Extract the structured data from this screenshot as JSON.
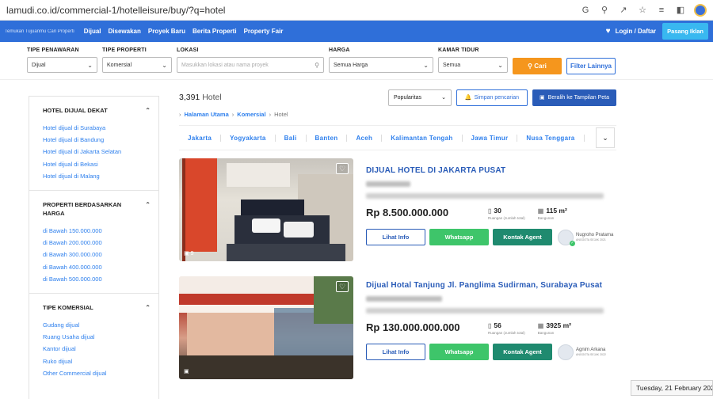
{
  "browser": {
    "url": "lamudi.co.id/commercial-1/hotelleisure/buy/?q=hotel",
    "icons": [
      "google-icon",
      "zoom-icon",
      "share-icon",
      "star-icon",
      "reading-list-icon",
      "sidebar-icon",
      "profile-icon"
    ]
  },
  "topnav": {
    "tagline": "Temukan Tujuanmu Cari Properti",
    "links": [
      "Dijual",
      "Disewakan",
      "Proyek Baru",
      "Berita Properti",
      "Property Fair"
    ],
    "login": "Login / Daftar",
    "pasang": "Pasang Iklan"
  },
  "filters": {
    "tipe_penawaran": {
      "label": "TIPE PENAWARAN",
      "value": "Dijual"
    },
    "tipe_properti": {
      "label": "TIPE PROPERTI",
      "value": "Komersial"
    },
    "lokasi": {
      "label": "LOKASI",
      "placeholder": "Masukkan lokasi atau nama proyek"
    },
    "harga": {
      "label": "HARGA",
      "value": "Semua Harga"
    },
    "kamar": {
      "label": "KAMAR TIDUR",
      "value": "Semua"
    },
    "cari": "Cari",
    "filter_lainnya": "Filter Lainnya"
  },
  "sidebar": {
    "sections": [
      {
        "title": "HOTEL DIJUAL DEKAT",
        "links": [
          "Hotel dijual di Surabaya",
          "Hotel dijual di Bandung",
          "Hotel dijual di Jakarta Selatan",
          "Hotel dijual di Bekasi",
          "Hotel dijual di Malang"
        ]
      },
      {
        "title": "PROPERTI BERDASARKAN HARGA",
        "links": [
          "di Bawah 150.000.000",
          "di Bawah 200.000.000",
          "di Bawah 300.000.000",
          "di Bawah 400.000.000",
          "di Bawah 500.000.000"
        ]
      },
      {
        "title": "TIPE KOMERSIAL",
        "links": [
          "Gudang dijual",
          "Ruang Usaha dijual",
          "Kantor dijual",
          "Ruko dijual",
          "Other Commercial dijual"
        ]
      }
    ]
  },
  "results": {
    "count": "3,391",
    "noun": "Hotel",
    "sort": "Popularitas",
    "simpan": "Simpan pencarian",
    "peta": "Beralih ke Tampilan Peta"
  },
  "breadcrumb": [
    "Halaman Utama",
    "Komersial",
    "Hotel"
  ],
  "loctabs": [
    "Jakarta",
    "Yogyakarta",
    "Bali",
    "Banten",
    "Aceh",
    "Kalimantan Tengah",
    "Jawa Timur",
    "Nusa Tenggara"
  ],
  "listings": [
    {
      "title": "DIJUAL HOTEL DI JAKARTA PUSAT",
      "price": "Rp 8.500.000.000",
      "rooms": "30",
      "rooms_label": "Ruangan (Jumlah total)",
      "area": "115 m²",
      "area_label": "Bangunan",
      "photos": "9",
      "agent": "Nugroho Pratama",
      "agent_since": "ANGGOTA SEJAK 2021"
    },
    {
      "title": "Dijual Hotal Tanjung Jl. Panglima Sudirman, Surabaya Pusat",
      "price": "Rp 130.000.000.000",
      "rooms": "56",
      "rooms_label": "Ruangan (Jumlah total)",
      "area": "3925 m²",
      "area_label": "Bangunan",
      "photos": "",
      "agent": "Agnim Arkana",
      "agent_since": "ANGGOTA SEJAK 2022"
    }
  ],
  "buttons": {
    "info": "Lihat Info",
    "wa": "Whatsapp",
    "agent": "Kontak Agent"
  },
  "tooltip": "Tuesday, 21 February 2023",
  "colors": {
    "brand": "#2f6fd9",
    "cta": "#f5961d",
    "whatsapp": "#3ec56a",
    "kontak": "#1f8a6f"
  }
}
